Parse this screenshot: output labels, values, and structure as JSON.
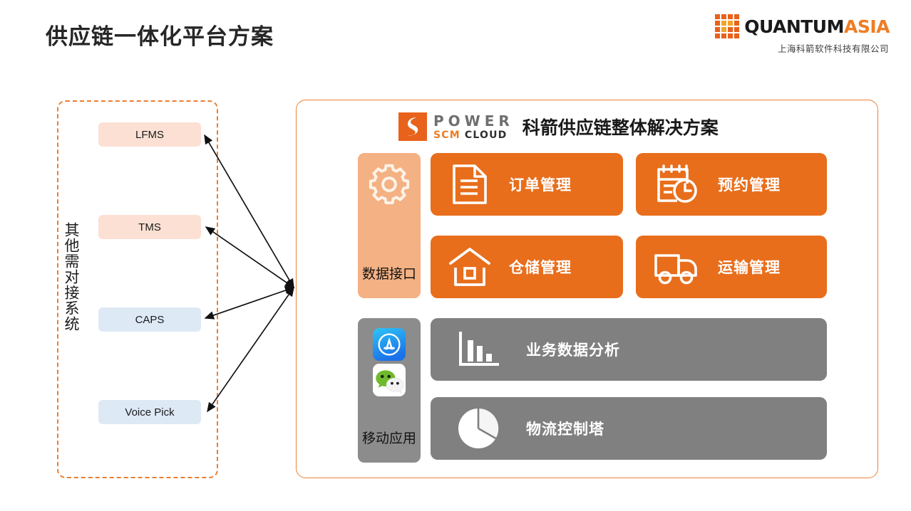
{
  "header": {
    "title": "供应链一体化平台方案",
    "brand": {
      "name_dark": "QUANTUM",
      "name_accent": "ASIA",
      "subtitle": "上海科箭软件科技有限公司",
      "accent_color": "#ED7D24",
      "dark_color": "#1A1A1A"
    }
  },
  "left_panel": {
    "label": "其他需对接系统",
    "border_color": "#ED7D31",
    "systems": [
      {
        "name": "LFMS",
        "color": "#FBE0D3",
        "style": "peach"
      },
      {
        "name": "TMS",
        "color": "#FBE0D3",
        "style": "peach"
      },
      {
        "name": "CAPS",
        "color": "#DEE9F6",
        "style": "blue"
      },
      {
        "name": "Voice Pick",
        "color": "#DEE9F6",
        "style": "blue"
      }
    ]
  },
  "main_panel": {
    "border_color": "#ED8037",
    "logo": {
      "mark": "power-s-mark",
      "word_power": "POWER",
      "word_scm": "SCM",
      "word_cloud": "CLOUD",
      "scm_color": "#ED7D24",
      "power_color": "#6F6F6F"
    },
    "title": "科箭供应链整体解决方案",
    "rails": [
      {
        "id": "data-interface",
        "label": "数据接口",
        "icon": "gear-icon",
        "bg": "#F4B183"
      },
      {
        "id": "mobile-apps",
        "label": "移动应用",
        "icons": [
          "app-store-icon",
          "wechat-icon"
        ],
        "bg": "#8C8C8C"
      }
    ],
    "cards": [
      {
        "id": "order",
        "label": "订单管理",
        "icon": "document-icon",
        "color": "#E86E1C"
      },
      {
        "id": "booking",
        "label": "预约管理",
        "icon": "calendar-clock-icon",
        "color": "#E86E1C"
      },
      {
        "id": "warehouse",
        "label": "仓储管理",
        "icon": "warehouse-house-icon",
        "color": "#E86E1C"
      },
      {
        "id": "transport",
        "label": "运输管理",
        "icon": "truck-icon",
        "color": "#E86E1C"
      },
      {
        "id": "analytics",
        "label": "业务数据分析",
        "icon": "bar-chart-icon",
        "color": "#808080"
      },
      {
        "id": "control-tower",
        "label": "物流控制塔",
        "icon": "pie-chart-icon",
        "color": "#808080"
      }
    ]
  },
  "connectors": {
    "hub_label": "integration-hub",
    "stroke_color": "#1A1A1A",
    "count": 4
  }
}
